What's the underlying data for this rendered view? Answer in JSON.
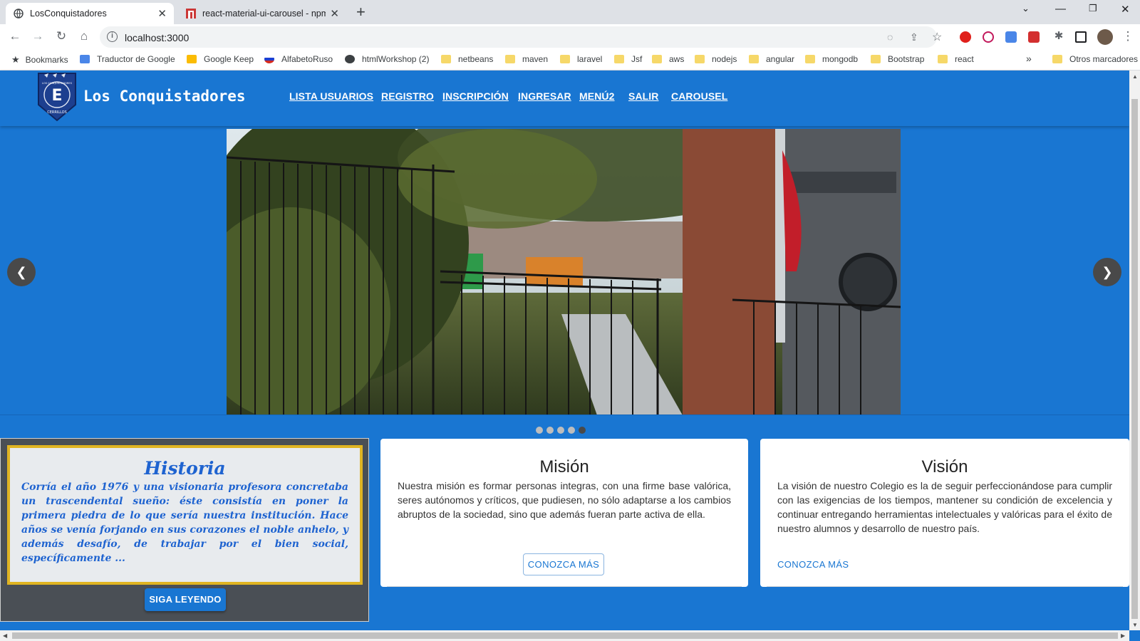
{
  "browser": {
    "tabs": [
      {
        "title": "LosConquistadores",
        "active": true,
        "icon": "globe-icon"
      },
      {
        "title": "react-material-ui-carousel - npm",
        "active": false,
        "icon": "npm-icon"
      }
    ],
    "address": "localhost:3000",
    "bookmarks": [
      {
        "label": "Bookmarks",
        "icon": "star-icon"
      },
      {
        "label": "Traductor de Google",
        "icon": "google-translate-icon"
      },
      {
        "label": "Google Keep",
        "icon": "keep-icon"
      },
      {
        "label": "AlfabetoRuso",
        "icon": "russia-flag-icon"
      },
      {
        "label": "htmlWorkshop (2)",
        "icon": "globe-icon"
      },
      {
        "label": "netbeans",
        "icon": "folder-icon"
      },
      {
        "label": "maven",
        "icon": "folder-icon"
      },
      {
        "label": "laravel",
        "icon": "folder-icon"
      },
      {
        "label": "Jsf",
        "icon": "folder-icon"
      },
      {
        "label": "aws",
        "icon": "folder-icon"
      },
      {
        "label": "nodejs",
        "icon": "folder-icon"
      },
      {
        "label": "angular",
        "icon": "folder-icon"
      },
      {
        "label": "mongodb",
        "icon": "folder-icon"
      },
      {
        "label": "Bootstrap",
        "icon": "folder-icon"
      },
      {
        "label": "react",
        "icon": "folder-icon"
      }
    ],
    "more_bookmarks": "»",
    "other_bookmarks": "Otros marcadores"
  },
  "header": {
    "brand": "Los Conquistadores",
    "logo_text_top": "LOS CONQUISTADORES",
    "logo_text_bottom": "CERRILLOS",
    "nav": [
      "LISTA USUARIOS",
      "REGISTRO",
      "INSCRIPCIÓN",
      "INGRESAR",
      "MENÚ2",
      "SALIR",
      "CAROUSEL"
    ]
  },
  "carousel": {
    "prev_icon": "chevron-left-icon",
    "next_icon": "chevron-right-icon",
    "slide_count": 5,
    "active_index": 4
  },
  "historia": {
    "title": "Historia",
    "text": "Corría el año 1976 y una visionaria profesora concretaba un trascendental sueño: éste consistía en poner la primera piedra de lo que sería nuestra institución. Hace años se venía forjando en sus corazones el noble anhelo, y además desafío, de trabajar por el bien social, específicamente ...",
    "button": "SIGA LEYENDO"
  },
  "mision": {
    "title": "Misión",
    "text": "Nuestra misión es formar personas integras, con una firme base valórica, seres autónomos y críticos, que pudiesen, no sólo adaptarse a los cambios abruptos de la sociedad, sino que además fueran parte activa de ella.",
    "button": "CONOZCA MÁS"
  },
  "vision": {
    "title": "Visión",
    "text": "La visión de nuestro Colegio es la de seguir perfeccionándose para cumplir con las exigencias de los tiempos, mantener su condición de excelencia y continuar entregando herramientas intelectuales y valóricas para el éxito de nuestro alumnos y desarrollo de nuestro país.",
    "button": "CONOZCA MÁS"
  },
  "colors": {
    "primary": "#1976d2",
    "historia_text": "#1e63d0",
    "historia_border": "#e0b422"
  }
}
